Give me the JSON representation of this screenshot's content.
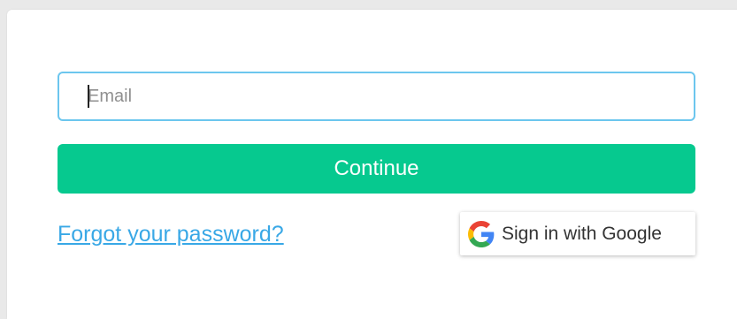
{
  "form": {
    "email": {
      "placeholder": "Email",
      "value": ""
    },
    "continue_label": "Continue",
    "forgot_password_label": "Forgot your password?",
    "google_signin_label": "Sign in with Google"
  },
  "icons": {
    "google": "google-g-icon"
  },
  "colors": {
    "continue_button": "#06c98f",
    "input_border": "#6cc6ee",
    "link": "#39a8e6",
    "background": "#e9e9e9",
    "card": "#ffffff"
  }
}
